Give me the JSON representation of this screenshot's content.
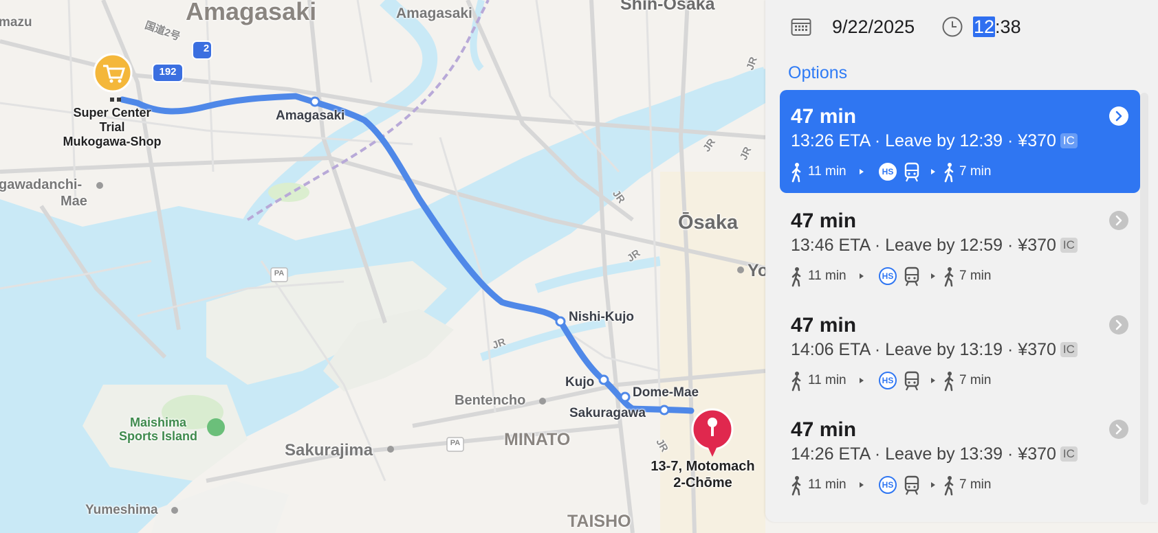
{
  "map": {
    "districts": [
      "Amagasaki",
      "MINATO",
      "TAISHO"
    ],
    "cities": [
      "Ōsaka",
      "Shin-Ōsaka",
      "Yo"
    ],
    "stations": [
      "Amagasaki",
      "Nishi-Kujo",
      "Kujo",
      "Dome-Mae",
      "Sakuragawa",
      "Bentencho",
      "Sakurajima",
      "Yumeshima",
      "Amagasaki",
      "gawadanchi-",
      "Mae",
      "mazu"
    ],
    "pois": {
      "start": [
        "Super Center",
        "Trial",
        "Mukogawa-Shop"
      ],
      "destination": [
        "13-7, Motomach",
        "2-Chōme"
      ],
      "park": [
        "Maishima",
        "Sports Island"
      ]
    },
    "road_shields": [
      "2",
      "192",
      "PA",
      "PA"
    ],
    "road_name": "国道2号",
    "jr_labels": [
      "JR",
      "JR",
      "JR",
      "JR",
      "JR",
      "JR",
      "JR"
    ],
    "icons": {
      "start": "shopping-cart-icon",
      "destination": "location-pin-icon"
    },
    "colors": {
      "route": "#4f88e8",
      "water": "#c7e8f5",
      "land": "#f3f1ec",
      "pin": "#e0284e"
    }
  },
  "panel": {
    "date": "9/22/2025",
    "time_hour": "12",
    "time_rest": ":38",
    "options_title": "Options",
    "options": [
      {
        "duration": "47 min",
        "summary": "13:26 ETA · Leave by 12:39 · ¥370",
        "fare_badge": "IC",
        "walk_start": "11 min",
        "line_badge": "HS",
        "walk_end": "7 min",
        "selected": true
      },
      {
        "duration": "47 min",
        "summary": "13:46 ETA · Leave by 12:59 · ¥370",
        "fare_badge": "IC",
        "walk_start": "11 min",
        "line_badge": "HS",
        "walk_end": "7 min",
        "selected": false
      },
      {
        "duration": "47 min",
        "summary": "14:06 ETA · Leave by 13:19 · ¥370",
        "fare_badge": "IC",
        "walk_start": "11 min",
        "line_badge": "HS",
        "walk_end": "7 min",
        "selected": false
      },
      {
        "duration": "47 min",
        "summary": "14:26 ETA · Leave by 13:39 · ¥370",
        "fare_badge": "IC",
        "walk_start": "11 min",
        "line_badge": "HS",
        "walk_end": "7 min",
        "selected": false
      }
    ],
    "icons": {
      "date": "calendar-icon",
      "time": "clock-icon",
      "walk": "walking-icon",
      "train": "train-icon",
      "chevron": "chevron-right-icon"
    },
    "colors": {
      "accent": "#2f76f2"
    }
  }
}
